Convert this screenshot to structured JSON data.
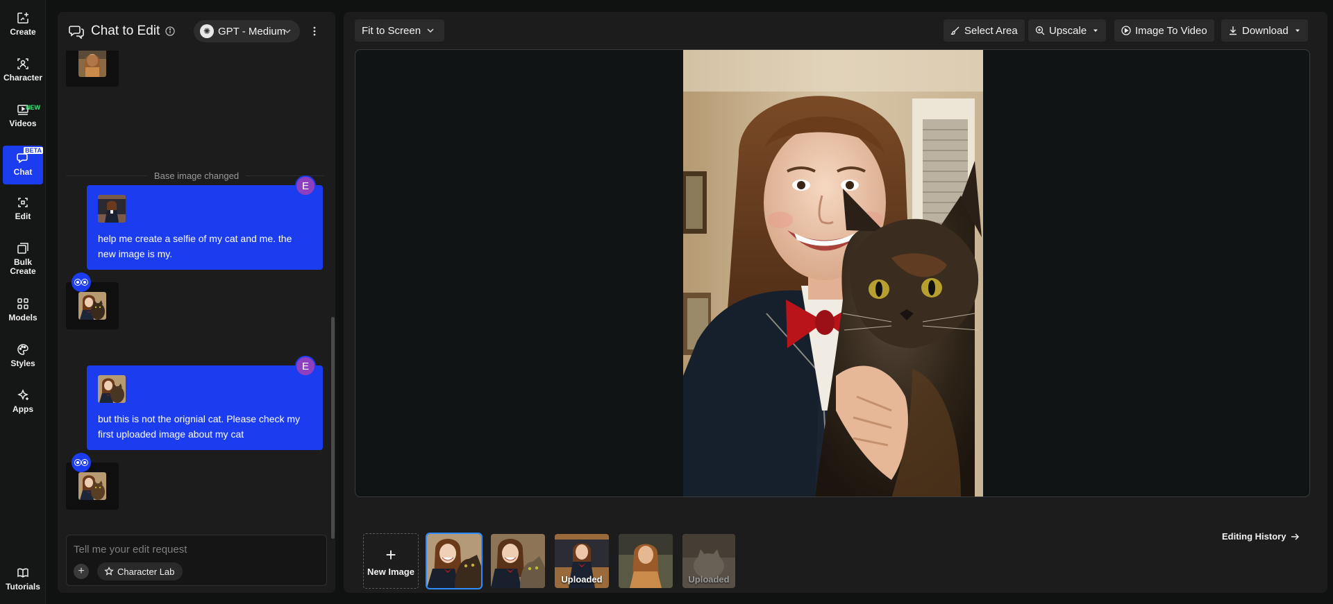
{
  "rail": {
    "items": [
      {
        "label": "Create",
        "icon": "create-icon"
      },
      {
        "label": "Character",
        "icon": "character-icon"
      },
      {
        "label": "Videos",
        "icon": "videos-icon",
        "badge": "NEW"
      },
      {
        "label": "Chat",
        "icon": "chat-icon",
        "badge": "BETA",
        "active": true
      },
      {
        "label": "Edit",
        "icon": "edit-icon"
      },
      {
        "label": "Bulk Create",
        "icon": "bulk-create-icon"
      },
      {
        "label": "Models",
        "icon": "models-icon"
      },
      {
        "label": "Styles",
        "icon": "styles-icon"
      },
      {
        "label": "Apps",
        "icon": "apps-icon"
      }
    ],
    "bottom": {
      "label": "Tutorials",
      "icon": "tutorials-icon"
    }
  },
  "chat": {
    "title": "Chat to Edit",
    "model": "GPT - Medium",
    "divider": "Base image changed",
    "messages": [
      {
        "author": "E",
        "text": "help me create a selfie of my cat and me. the new image is my."
      },
      {
        "author": "E",
        "text": "but this is not the orignial cat. Please check my first uploaded image about my cat"
      }
    ],
    "input_placeholder": "Tell me your edit request",
    "character_lab": "Character Lab"
  },
  "toolbar": {
    "fit": "Fit to Screen",
    "select_area": "Select Area",
    "upscale": "Upscale",
    "image_to_video": "Image To Video",
    "download": "Download"
  },
  "history": {
    "new_image": "New Image",
    "uploaded_1": "Uploaded",
    "uploaded_2": "Uploaded",
    "editing_history": "Editing History"
  },
  "colors": {
    "accent": "#1c3cf0",
    "user_avatar": "#8e3fbf",
    "selected_outline": "#2d8cff",
    "new_badge": "#3ee27a"
  }
}
